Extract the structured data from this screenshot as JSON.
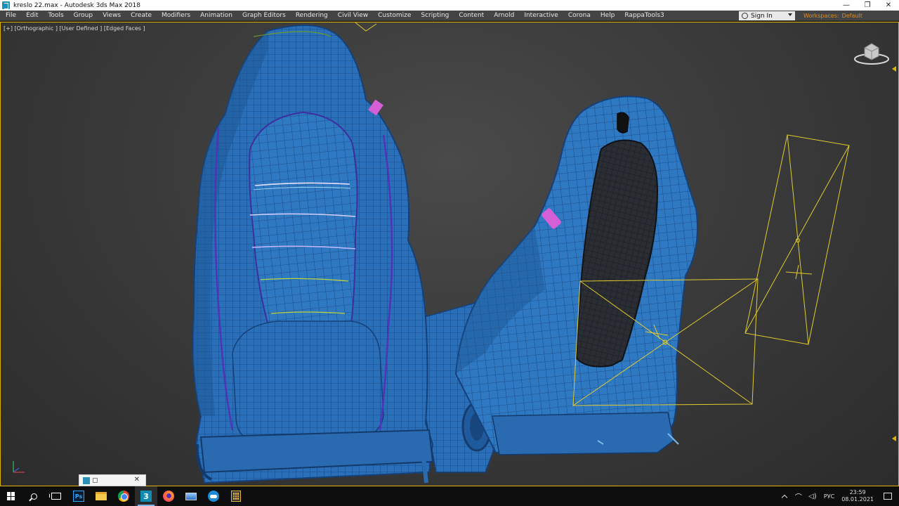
{
  "window": {
    "title": "kreslo 22.max - Autodesk 3ds Max 2018",
    "controls": {
      "minimize": "—",
      "maximize": "❐",
      "close": "✕"
    }
  },
  "menu": {
    "items": [
      "File",
      "Edit",
      "Tools",
      "Group",
      "Views",
      "Create",
      "Modifiers",
      "Animation",
      "Graph Editors",
      "Rendering",
      "Civil View",
      "Customize",
      "Scripting",
      "Content",
      "Arnold",
      "Interactive",
      "Corona",
      "Help",
      "RappaTools3"
    ],
    "sign_in": "Sign In",
    "workspaces_label": "Workspaces:",
    "workspaces_value": "Default"
  },
  "viewport": {
    "label": "[+] [Orthographic ] [User Defined ] [Edged Faces ]",
    "accent_color": "#d9b400",
    "mesh_color": "#2a6fb8",
    "wire_color": "#16417a",
    "gizmo_color": "#e0cc2e",
    "tag_color": "#d45fd6"
  },
  "mini_panel": {
    "close": "✕"
  },
  "taskbar": {
    "apps": [
      "windows-start",
      "search",
      "task-view",
      "photoshop",
      "file-explorer",
      "chrome",
      "3ds-max",
      "firefox",
      "remote-desktop",
      "browser",
      "calculator"
    ],
    "language": "РУС",
    "time": "23:59",
    "date": "08.01.2021"
  }
}
